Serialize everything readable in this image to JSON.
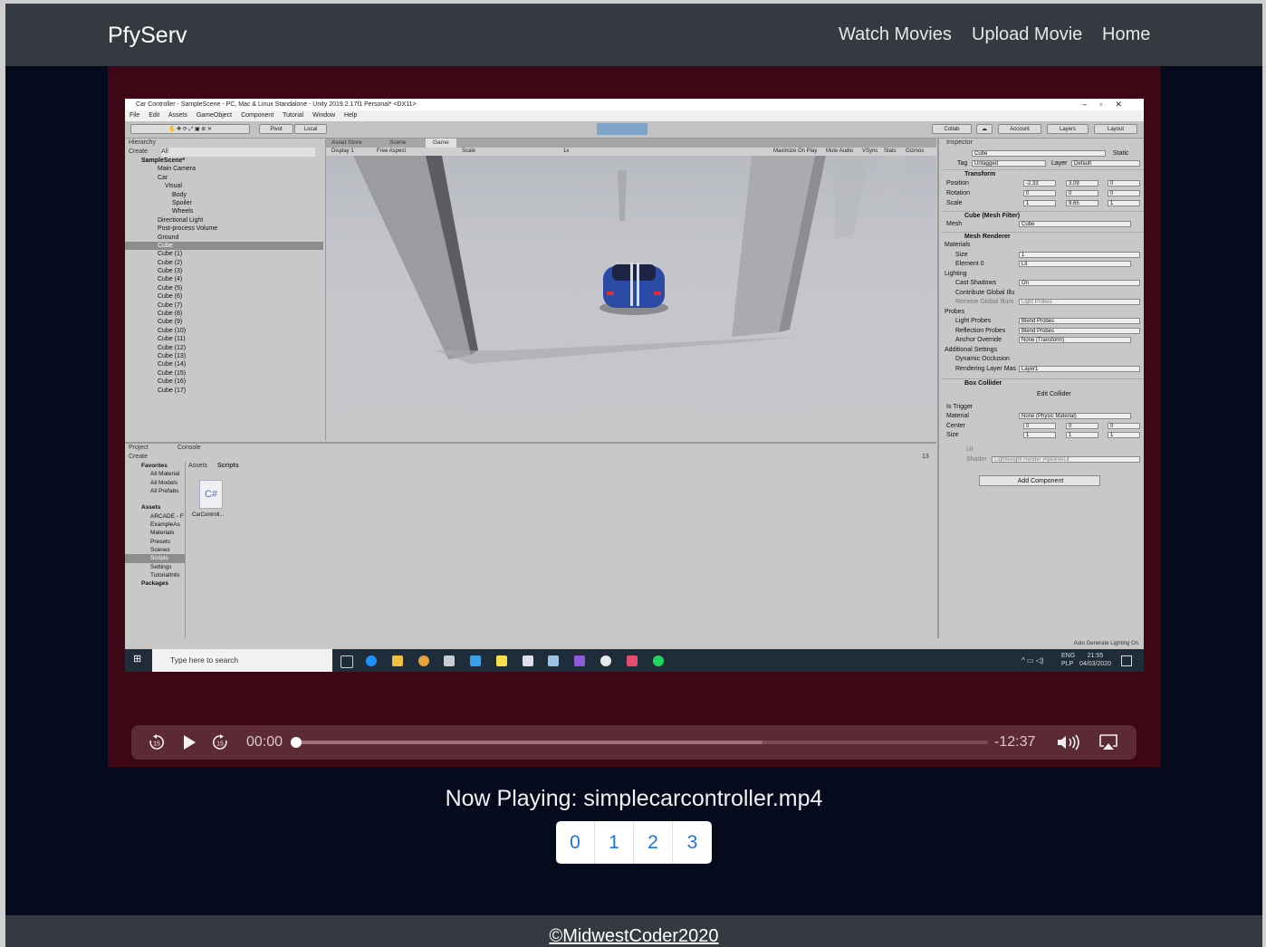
{
  "navbar": {
    "brand": "PfyServ",
    "links": [
      "Watch Movies",
      "Upload Movie",
      "Home"
    ]
  },
  "video_frame": {
    "window_title": "Car Controller - SampleScene - PC, Mac & Linux Standalone - Unity 2019.2.17f1 Personal* <DX11>",
    "menu": [
      "File",
      "Edit",
      "Assets",
      "GameObject",
      "Component",
      "Tutorial",
      "Window",
      "Help"
    ],
    "toolbar": {
      "pivot": "Pivot",
      "local": "Local",
      "collab": "Collab",
      "account": "Account",
      "layers": "Layers",
      "layout": "Layout"
    },
    "hierarchy": {
      "tab": "Hierarchy",
      "create": "Create",
      "search": "All",
      "items": [
        "SampleScene*",
        "Main Camera",
        "Car",
        "Visual",
        "Body",
        "Spoiler",
        "Wheels",
        "Directional Light",
        "Post-process Volume",
        "Ground",
        "Cube",
        "Cube (1)",
        "Cube (2)",
        "Cube (3)",
        "Cube (4)",
        "Cube (5)",
        "Cube (6)",
        "Cube (7)",
        "Cube (8)",
        "Cube (9)",
        "Cube (10)",
        "Cube (11)",
        "Cube (12)",
        "Cube (13)",
        "Cube (14)",
        "Cube (15)",
        "Cube (16)",
        "Cube (17)"
      ]
    },
    "game_tabs": [
      "Asset Store",
      "Scene",
      "Game"
    ],
    "game_bar": {
      "display": "Display 1",
      "aspect": "Free Aspect",
      "scale": "Scale",
      "scale_value": "1x",
      "options": [
        "Maximize On Play",
        "Mute Audio",
        "VSync",
        "Stats",
        "Gizmos"
      ]
    },
    "inspector": {
      "tab": "Inspector",
      "object_name": "Cube",
      "static": "Static",
      "tag_label": "Tag",
      "tag": "Untagged",
      "layer_label": "Layer",
      "layer": "Default",
      "transform": "Transform",
      "position_label": "Position",
      "position": [
        "-2.33",
        "3.09",
        "0"
      ],
      "rotation_label": "Rotation",
      "rotation": [
        "0",
        "0",
        "0"
      ],
      "scale_label": "Scale",
      "scale": [
        "1",
        "9.65",
        "1"
      ],
      "mesh_filter": "Cube (Mesh Filter)",
      "mesh_label": "Mesh",
      "mesh": "Cube",
      "mesh_renderer": "Mesh Renderer",
      "materials": "Materials",
      "size_label": "Size",
      "size": "1",
      "element0_label": "Element 0",
      "element0": "Lit",
      "lighting": "Lighting",
      "cast_shadows_label": "Cast Shadows",
      "cast_shadows": "On",
      "contribute_gi": "Contribute Global Illu",
      "receive_gi": "Receive Global Illum",
      "receive_gi_value": "Light Probes",
      "probes": "Probes",
      "light_probes_label": "Light Probes",
      "light_probes": "Blend Probes",
      "reflection_probes_label": "Reflection Probes",
      "reflection_probes": "Blend Probes",
      "anchor_label": "Anchor Override",
      "anchor": "None (Transform)",
      "additional": "Additional Settings",
      "dynamic_occlusion": "Dynamic Occlusion",
      "rendering_layer_label": "Rendering Layer Mas",
      "rendering_layer": "Layer1",
      "box_collider": "Box Collider",
      "edit_collider": "Edit Collider",
      "is_trigger": "Is Trigger",
      "material_label": "Material",
      "material": "None (Physic Material)",
      "center_label": "Center",
      "center": [
        "0",
        "0",
        "0"
      ],
      "size2_label": "Size",
      "size2": [
        "1",
        "1",
        "1"
      ],
      "lit": "Lit",
      "shader_label": "Shader",
      "shader": "Lightweight Render Pipeline/Lit",
      "add_component": "Add Component"
    },
    "project": {
      "tabs": [
        "Project",
        "Console"
      ],
      "create": "Create",
      "count": "13",
      "breadcrumb": [
        "Assets",
        "Scripts"
      ],
      "favorites": "Favorites",
      "favorite_items": [
        "All Material",
        "All Models",
        "All Prefabs"
      ],
      "assets": "Assets",
      "asset_items": [
        "ARCADE - F",
        "ExampleAs",
        "Materials",
        "Presets",
        "Scenes",
        "Scripts",
        "Settings",
        "TutorialInfo"
      ],
      "packages": "Packages",
      "file_icon": "C#",
      "file_name": "CarControll..."
    },
    "status": "Auto Generate Lighting On",
    "taskbar": {
      "search_placeholder": "Type here to search",
      "lang": "ENG",
      "region": "PLP",
      "time": "21:55",
      "date": "04/03/2020"
    }
  },
  "controls": {
    "current_time": "00:00",
    "remaining_time": "-12:37",
    "progress": 0.0,
    "buffered_fraction": 0.675,
    "icons": [
      "skip-back-15-icon",
      "play-icon",
      "skip-forward-15-icon",
      "volume-icon",
      "airplay-icon"
    ]
  },
  "now_playing": "Now Playing: simplecarcontroller.mp4",
  "pagination": [
    "0",
    "1",
    "2",
    "3"
  ],
  "footer": "©MidwestCoder2020",
  "colors": {
    "navbar": "#343a40",
    "background": "#050a1c",
    "player": "#3e0716",
    "link": "#1a73e8"
  }
}
